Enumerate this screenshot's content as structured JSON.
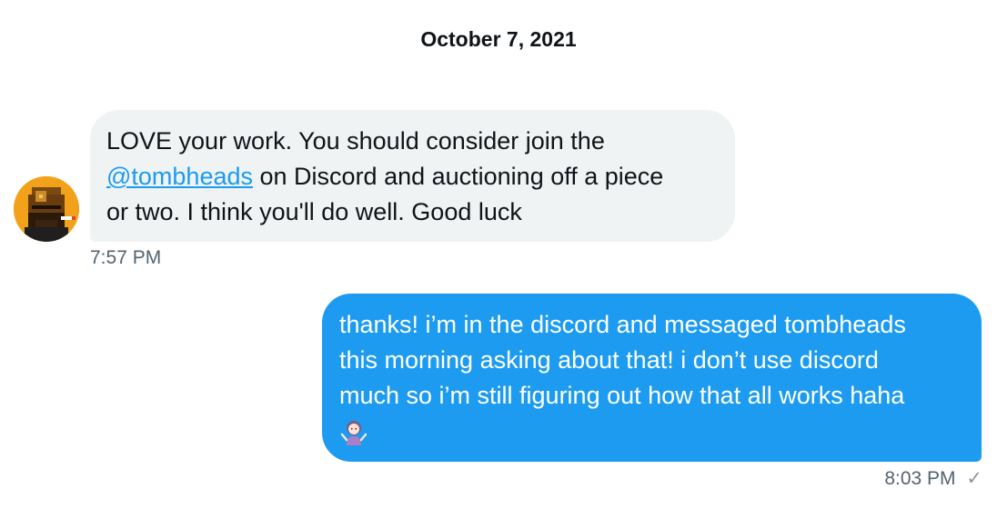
{
  "conversation": {
    "date": "October 7, 2021",
    "received": {
      "lines": [
        "LOVE your work. You should consider join the",
        "on Discord and auctioning off a piece",
        "or two. I think you'll do well. Good luck"
      ],
      "mention": "@tombheads",
      "time": "7:57 PM",
      "avatar_icon": "pixel-art-avatar-icon"
    },
    "sent": {
      "lines": [
        "thanks! i’m in the discord and messaged tombheads",
        "this morning asking about that! i don’t use discord",
        "much so i’m still figuring out how that all works haha"
      ],
      "emoji_icon": "person-shrugging-emoji-icon",
      "time": "8:03 PM",
      "status_icon": "✓"
    },
    "colors": {
      "sent_bubble": "#1d9bf0",
      "received_bubble": "#eff3f4",
      "link": "#1d9bf0",
      "meta_text": "#536471"
    }
  }
}
